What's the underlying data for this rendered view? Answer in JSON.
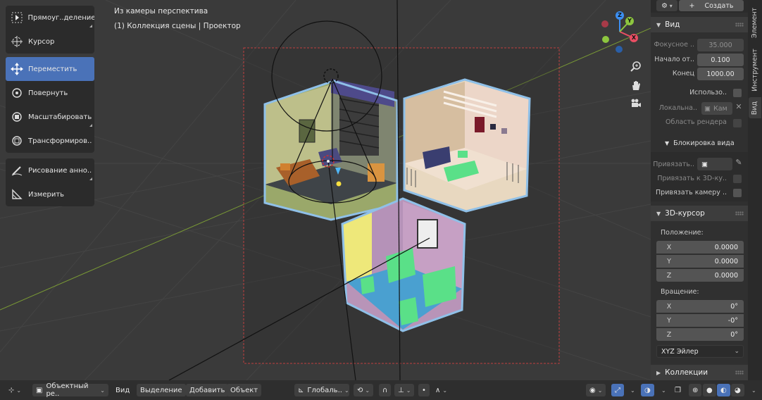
{
  "viewport": {
    "info_line1": "Из камеры перспектива",
    "info_line2": "(1) Коллекция сцены | Проектор"
  },
  "toolbar": {
    "tools": [
      {
        "label": "Прямоуг..деление",
        "icon": "select-box-icon"
      },
      {
        "label": "Курсор",
        "icon": "cursor-icon"
      },
      {
        "label": "Переместить",
        "icon": "move-icon",
        "active": true
      },
      {
        "label": "Повернуть",
        "icon": "rotate-icon"
      },
      {
        "label": "Масштабировать",
        "icon": "scale-icon"
      },
      {
        "label": "Трансформиров..",
        "icon": "transform-icon"
      },
      {
        "label": "Рисование анно..",
        "icon": "annotate-icon"
      },
      {
        "label": "Измерить",
        "icon": "measure-icon"
      }
    ]
  },
  "gizmo": {
    "z": "Z",
    "y": "Y",
    "x": "X"
  },
  "npanel": {
    "create_label": "Создать",
    "tabs": [
      "Элемент",
      "Инструмент",
      "Вид"
    ],
    "view": {
      "header": "Вид",
      "focal_label": "Фокусное ..",
      "focal_value": "35.000",
      "clip_start_label": "Начало от..",
      "clip_start_value": "0.100",
      "clip_end_label": "Конец",
      "clip_end_value": "1000.00",
      "use_label": "Использо..",
      "local_label": "Локальна..",
      "local_value": "Кам",
      "render_region_label": "Область рендера"
    },
    "lock": {
      "header": "Блокировка вида",
      "bind_label": "Привязать..",
      "bind_3d_label": "Привязать к 3D-ку..",
      "bind_camera_label": "Привязать камеру .."
    },
    "cursor": {
      "header": "3D-курсор",
      "position_label": "Положение:",
      "x_label": "X",
      "x_value": "0.0000",
      "y_label": "Y",
      "y_value": "0.0000",
      "z_label": "Z",
      "z_value": "0.0000",
      "rotation_label": "Вращение:",
      "rx_label": "X",
      "rx_value": "0°",
      "ry_label": "Y",
      "ry_value": "-0°",
      "rz_label": "Z",
      "rz_value": "0°",
      "mode_value": "XYZ Эйлер"
    },
    "collections_header": "Коллекции"
  },
  "bottom": {
    "mode": "Объектный ре..",
    "menu_view": "Вид",
    "menu_select": "Выделение",
    "menu_add": "Добавить",
    "menu_object": "Объект",
    "orientation": "Глобаль.."
  },
  "colors": {
    "accent": "#4a72b8",
    "axis_x": "#e84e63",
    "axis_y": "#8dc63f",
    "axis_z": "#3c8ff2"
  }
}
